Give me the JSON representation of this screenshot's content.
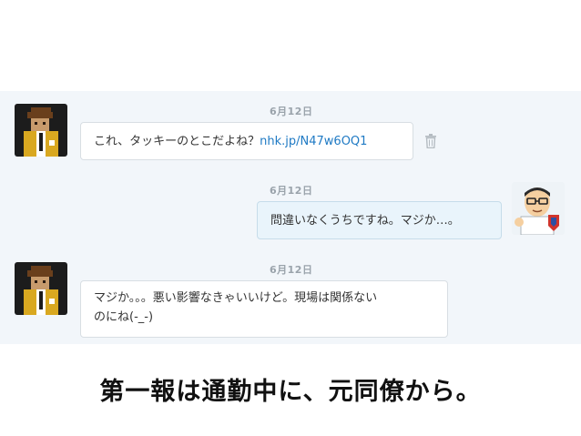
{
  "messages": [
    {
      "date": "6月12日",
      "text": "これ、タッキーのとこだよね？",
      "link": "nhk.jp/N47w6OQ1",
      "avatar_icon": "pixel-person-avatar-icon"
    },
    {
      "date": "6月12日",
      "text": "問違いなくうちですね。マジか…。",
      "avatar_icon": "cartoon-man-glasses-avatar-icon"
    },
    {
      "date": "6月12日",
      "line1": "マジか。。。悪い影響なきゃいいけど。現場は関係ない",
      "line2": "のにね(-_-)",
      "avatar_icon": "pixel-person-avatar-icon"
    }
  ],
  "caption": "第一報は通勤中に、元同僚から。",
  "colors": {
    "link": "#1f7ac4",
    "panel_bg": "#f2f6fa",
    "outgoing_bubble": "#e9f4fb"
  }
}
